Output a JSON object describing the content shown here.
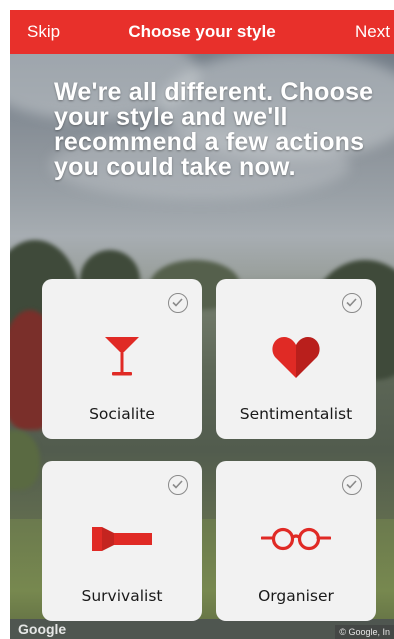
{
  "header": {
    "skip_label": "Skip",
    "title": "Choose your style",
    "next_label": "Next"
  },
  "headline": "We're all different. Choose your style and we'll recommend a few actions you could take now.",
  "cards": [
    {
      "label": "Socialite",
      "icon": "cocktail-glass-icon"
    },
    {
      "label": "Sentimentalist",
      "icon": "heart-icon"
    },
    {
      "label": "Survivalist",
      "icon": "flashlight-icon"
    },
    {
      "label": "Organiser",
      "icon": "glasses-icon"
    }
  ],
  "attribution": {
    "logo": "Google",
    "copyright": "© Google, In"
  },
  "colors": {
    "accent": "#e8302b",
    "icon_red": "#e02a25",
    "card_bg": "#f2f2f2"
  }
}
